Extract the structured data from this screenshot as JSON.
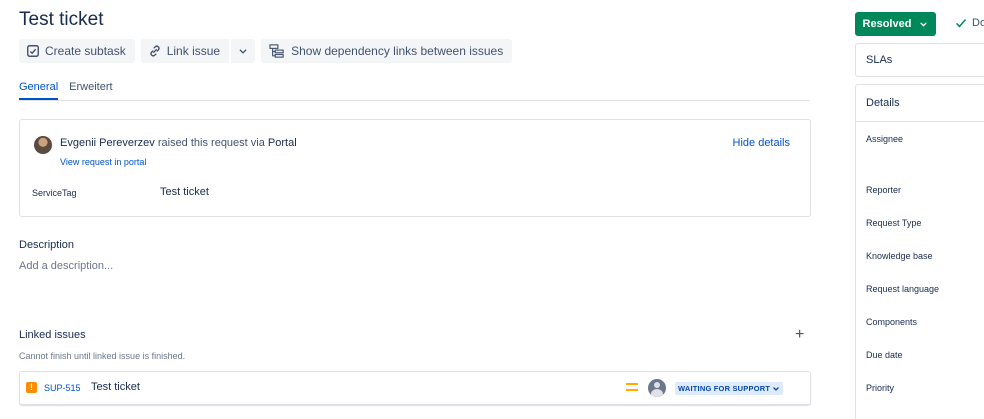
{
  "issue": {
    "title": "Test ticket"
  },
  "toolbar": {
    "create_subtask": "Create subtask",
    "link_issue": "Link issue",
    "show_dependency": "Show dependency links between issues"
  },
  "tabs": [
    {
      "label": "General",
      "active": true
    },
    {
      "label": "Erweitert",
      "active": false
    }
  ],
  "request": {
    "reporter_name": "Evgenii Pereverzev",
    "raised_text": "raised this request via",
    "channel": "Portal",
    "view_portal_link": "View request in portal",
    "hide_details": "Hide details",
    "fields": [
      {
        "label": "ServiceTag",
        "value": "Test ticket"
      }
    ]
  },
  "description": {
    "title": "Description",
    "placeholder": "Add a description..."
  },
  "linked_issues": {
    "title": "Linked issues",
    "add_symbol": "+",
    "note": "Cannot finish until linked issue is finished.",
    "items": [
      {
        "key": "SUP-515",
        "summary": "Test ticket",
        "priority_icon": "medium-priority-icon",
        "status": "WAITING FOR SUPPORT"
      }
    ]
  },
  "sidebar": {
    "status_button": "Resolved",
    "done_label": "Done",
    "sla_title": "SLAs",
    "details_title": "Details",
    "detail_labels": [
      "Assignee",
      "Reporter",
      "Request Type",
      "Knowledge base",
      "Request language",
      "Components",
      "Due date",
      "Priority"
    ]
  },
  "colors": {
    "primary_text": "#172b4d",
    "link": "#0052cc",
    "resolved_green": "#00875a",
    "status_lozenge_bg": "#deebff",
    "issue_type_orange": "#ff8b00",
    "priority_yellow": "#ffab00"
  }
}
